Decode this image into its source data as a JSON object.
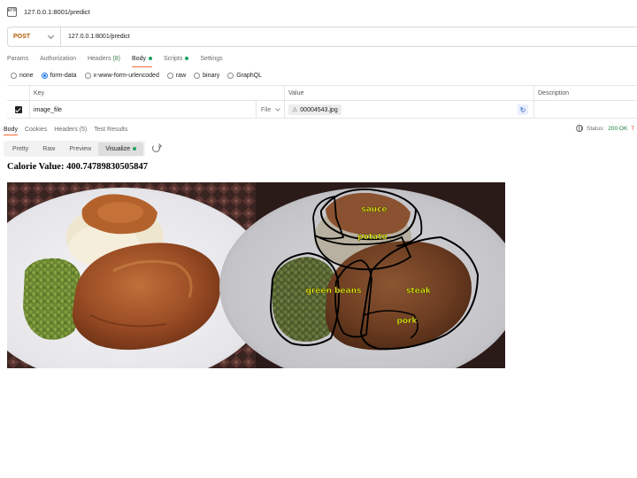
{
  "window": {
    "url": "127.0.0.1:8001/predict",
    "icon": "http-icon"
  },
  "request": {
    "method": "POST",
    "url": "127.0.0.1:8001/predict",
    "tabs": [
      {
        "label": "Params",
        "active": false
      },
      {
        "label": "Authorization",
        "active": false
      },
      {
        "label": "Headers",
        "count": "(8)",
        "active": false
      },
      {
        "label": "Body",
        "active": true,
        "dot": true
      },
      {
        "label": "Scripts",
        "active": false,
        "dot": true
      },
      {
        "label": "Settings",
        "active": false
      }
    ],
    "body_types": [
      {
        "label": "none",
        "selected": false
      },
      {
        "label": "form-data",
        "selected": true
      },
      {
        "label": "x-www-form-urlencoded",
        "selected": false
      },
      {
        "label": "raw",
        "selected": false
      },
      {
        "label": "binary",
        "selected": false
      },
      {
        "label": "GraphQL",
        "selected": false
      }
    ],
    "table": {
      "headers": {
        "key": "Key",
        "value": "Value",
        "description": "Description"
      },
      "rows": [
        {
          "checked": true,
          "key": "image_file",
          "type": "File",
          "value": "00004543.jpg",
          "description": ""
        }
      ]
    }
  },
  "response": {
    "tabs": [
      {
        "label": "Body",
        "active": true
      },
      {
        "label": "Cookies",
        "active": false
      },
      {
        "label": "Headers (5)",
        "active": false
      },
      {
        "label": "Test Results",
        "active": false
      }
    ],
    "status": {
      "label": "Status:",
      "value": "200 OK",
      "extra": "T"
    },
    "view_tabs": [
      {
        "label": "Pretty",
        "active": false
      },
      {
        "label": "Raw",
        "active": false
      },
      {
        "label": "Preview",
        "active": false
      },
      {
        "label": "Visualize",
        "active": true,
        "dot": true
      }
    ],
    "visualize": {
      "calorie_text": "Calorie Value: 400.74789830505847",
      "labels": {
        "sauce": "sauce",
        "potato": "potato",
        "green_beans": "green beans",
        "steak": "steak",
        "pork": "pork"
      },
      "label_color": "#f2f21a"
    }
  },
  "colors": {
    "accent": "#ff6c37",
    "method": "#b35b00",
    "ok": "#1a7f3c",
    "dot": "#1aa260"
  }
}
